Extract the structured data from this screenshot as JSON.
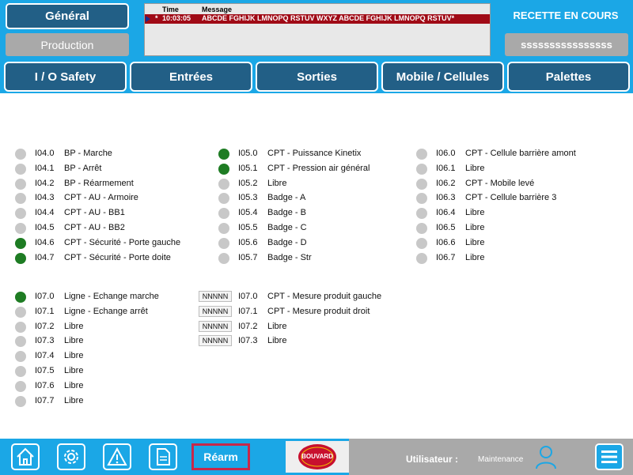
{
  "header": {
    "general_label": "Général",
    "production_label": "Production",
    "alarm": {
      "col_time": "Time",
      "col_message": "Message",
      "row": {
        "marker": "*",
        "time": "10:03:05",
        "message": "ABCDE FGHIJK LMNOPQ RSTUV WXYZ ABCDE FGHIJK LMNOPQ RSTUV*"
      }
    },
    "status_title": "RECETTE EN COURS",
    "status_value": "ssssssssssssssss"
  },
  "tabs": [
    "I / O Safety",
    "Entrées",
    "Sorties",
    "Mobile / Cellules",
    "Palettes"
  ],
  "inputs": {
    "col1": [
      {
        "addr": "I04.0",
        "label": "BP - Marche",
        "on": false
      },
      {
        "addr": "I04.1",
        "label": "BP - Arrêt",
        "on": false
      },
      {
        "addr": "I04.2",
        "label": "BP - Réarmement",
        "on": false
      },
      {
        "addr": "I04.3",
        "label": "CPT - AU - Armoire",
        "on": false
      },
      {
        "addr": "I04.4",
        "label": "CPT - AU - BB1",
        "on": false
      },
      {
        "addr": "I04.5",
        "label": "CPT - AU - BB2",
        "on": false
      },
      {
        "addr": "I04.6",
        "label": "CPT - Sécurité - Porte gauche",
        "on": true
      },
      {
        "addr": "I04.7",
        "label": "CPT - Sécurité - Porte doite",
        "on": true
      }
    ],
    "col2": [
      {
        "addr": "I05.0",
        "label": "CPT - Puissance Kinetix",
        "on": true
      },
      {
        "addr": "I05.1",
        "label": "CPT - Pression air général",
        "on": true
      },
      {
        "addr": "I05.2",
        "label": "Libre",
        "on": false
      },
      {
        "addr": "I05.3",
        "label": "Badge - A",
        "on": false
      },
      {
        "addr": "I05.4",
        "label": "Badge - B",
        "on": false
      },
      {
        "addr": "I05.5",
        "label": "Badge - C",
        "on": false
      },
      {
        "addr": "I05.6",
        "label": "Badge - D",
        "on": false
      },
      {
        "addr": "I05.7",
        "label": "Badge - Str",
        "on": false
      }
    ],
    "col3": [
      {
        "addr": "I06.0",
        "label": "CPT - Cellule barrière amont",
        "on": false
      },
      {
        "addr": "I06.1",
        "label": "Libre",
        "on": false
      },
      {
        "addr": "I06.2",
        "label": "CPT - Mobile levé",
        "on": false
      },
      {
        "addr": "I06.3",
        "label": "CPT - Cellule barrière 3",
        "on": false
      },
      {
        "addr": "I06.4",
        "label": "Libre",
        "on": false
      },
      {
        "addr": "I06.5",
        "label": "Libre",
        "on": false
      },
      {
        "addr": "I06.6",
        "label": "Libre",
        "on": false
      },
      {
        "addr": "I06.7",
        "label": "Libre",
        "on": false
      }
    ],
    "col4": [
      {
        "addr": "I07.0",
        "label": "Ligne - Echange marche",
        "on": true
      },
      {
        "addr": "I07.1",
        "label": "Ligne - Echange arrêt",
        "on": false
      },
      {
        "addr": "I07.2",
        "label": "Libre",
        "on": false
      },
      {
        "addr": "I07.3",
        "label": "Libre",
        "on": false
      },
      {
        "addr": "I07.4",
        "label": "Libre",
        "on": false
      },
      {
        "addr": "I07.5",
        "label": "Libre",
        "on": false
      },
      {
        "addr": "I07.6",
        "label": "Libre",
        "on": false
      },
      {
        "addr": "I07.7",
        "label": "Libre",
        "on": false
      }
    ],
    "analog": [
      {
        "value": "NNNNN",
        "addr": "I07.0",
        "label": "CPT - Mesure produit gauche"
      },
      {
        "value": "NNNNN",
        "addr": "I07.1",
        "label": "CPT - Mesure produit droit"
      },
      {
        "value": "NNNNN",
        "addr": "I07.2",
        "label": "Libre"
      },
      {
        "value": "NNNNN",
        "addr": "I07.3",
        "label": "Libre"
      }
    ]
  },
  "footer": {
    "buttons": [
      "home-icon",
      "gear-icon",
      "warning-icon",
      "document-icon"
    ],
    "rearm_label": "Réarm",
    "logo_text": "BOUVARD",
    "user_label": "Utilisateur :",
    "user_value": "Maintenance",
    "menu_icon": "hamburger-menu-icon"
  },
  "colors": {
    "accent": "#1ba7e6",
    "button_dark": "#225f86",
    "led_on": "#1e7c23",
    "led_off": "#c8c8c8",
    "alarm": "#a00a16",
    "rearm_border": "#c7284a"
  }
}
